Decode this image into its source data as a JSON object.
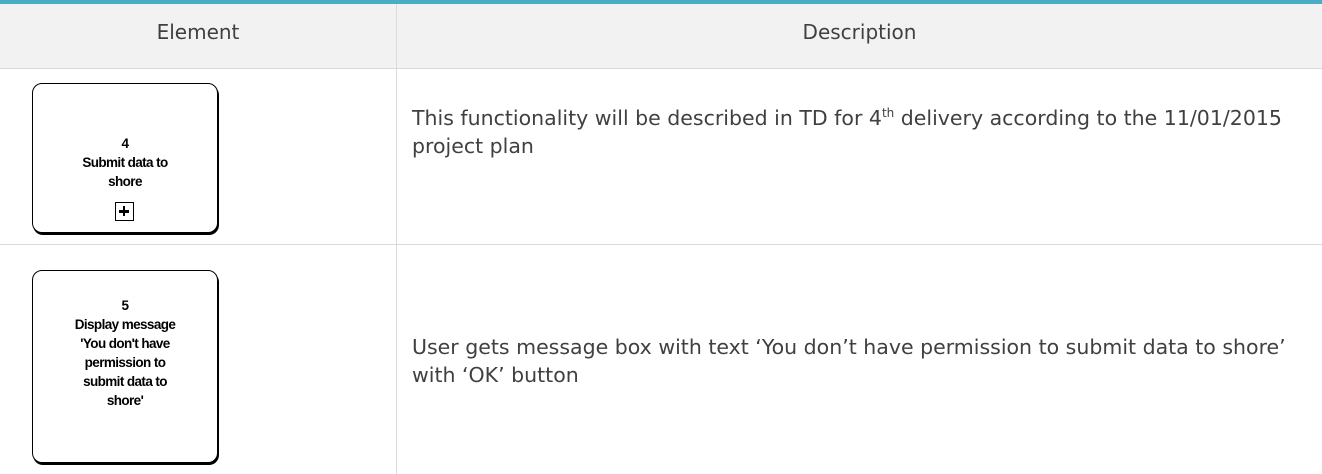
{
  "header": {
    "element_label": "Element",
    "description_label": "Description"
  },
  "rows": [
    {
      "element": {
        "lines": [
          "4",
          "Submit data to",
          "shore"
        ],
        "has_plus_marker": true
      },
      "description": {
        "text_before_sup": "This functionality will be described in TD for 4",
        "sup": "th",
        "text_after_sup": " delivery according to the 11/01/2015 project plan"
      }
    },
    {
      "element": {
        "lines": [
          "5",
          "Display message",
          "'You don't have",
          "permission to",
          "submit data to",
          "shore'"
        ],
        "has_plus_marker": false
      },
      "description": {
        "text": "User gets message box with text ‘You don’t have permission to submit data to shore’ with ‘OK’ button"
      }
    }
  ],
  "colors": {
    "header_accent": "#4bacc6",
    "header_background": "#f2f2f2",
    "grid_line": "#dadada"
  }
}
